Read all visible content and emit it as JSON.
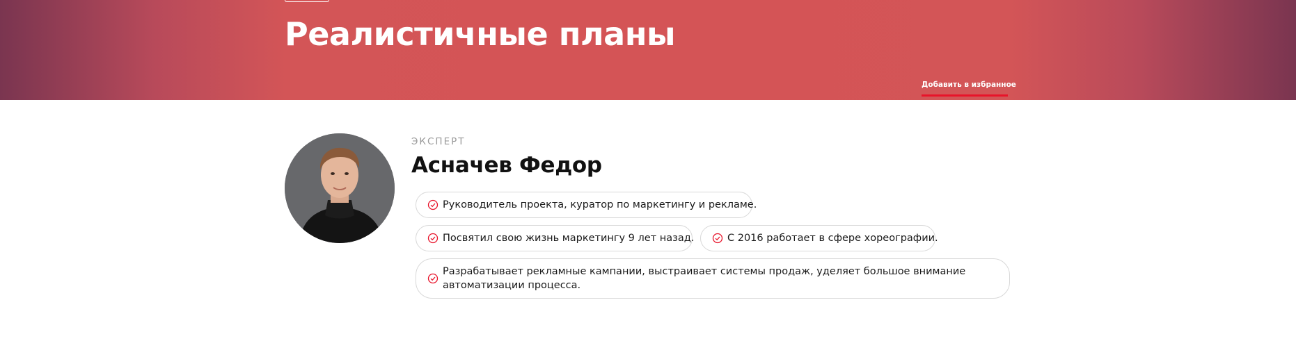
{
  "hero": {
    "title": "Реалистичные планы",
    "favorite_link": "Добавить в избранное",
    "accent_color": "#e8132a"
  },
  "expert": {
    "label": "ЭКСПЕРТ",
    "name": "Асначев Федор",
    "facts": [
      "Руководитель проекта, куратор по маркетингу и рекламе.",
      "Посвятил свою жизнь маркетингу 9 лет назад.",
      "С 2016 работает в сфере хореографии.",
      "Разрабатывает рекламные кампании, выстраивает системы продаж, уделяет большое внимание автоматизации процесса."
    ],
    "fact_icon": "check-circle-icon",
    "icon_color": "#e8132a"
  }
}
